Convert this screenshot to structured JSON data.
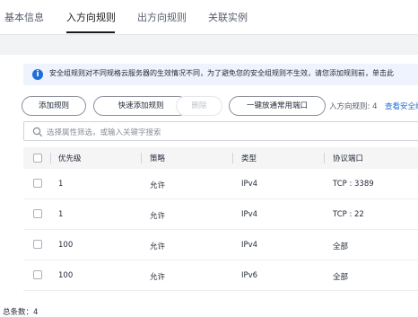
{
  "tabs": [
    {
      "label": "基本信息"
    },
    {
      "label": "入方向规则"
    },
    {
      "label": "出方向规则"
    },
    {
      "label": "关联实例"
    }
  ],
  "notice": {
    "icon": "info-icon",
    "text": "安全组规则对不同规格云服务器的生效情况不同，为了避免您的安全组规则不生效，请您添加规则前，单击此"
  },
  "toolbar": {
    "add_rule": "添加规则",
    "quick_add_rule": "快速添加规则",
    "delete": "删除",
    "open_common_ports": "一键放通常用端口",
    "rule_count": "入方向规则: 4",
    "view_link": "查看安全组"
  },
  "search": {
    "placeholder": "选择属性筛选，或输入关键字搜索"
  },
  "table": {
    "columns": [
      "优先级",
      "策略",
      "类型",
      "协议端口"
    ],
    "rows": [
      {
        "priority": "1",
        "policy": "允许",
        "type": "IPv4",
        "port": "TCP : 3389"
      },
      {
        "priority": "1",
        "policy": "允许",
        "type": "IPv4",
        "port": "TCP : 22"
      },
      {
        "priority": "100",
        "policy": "允许",
        "type": "IPv4",
        "port": "全部"
      },
      {
        "priority": "100",
        "policy": "允许",
        "type": "IPv6",
        "port": "全部"
      }
    ]
  },
  "footer": {
    "total": "总条数：4"
  }
}
